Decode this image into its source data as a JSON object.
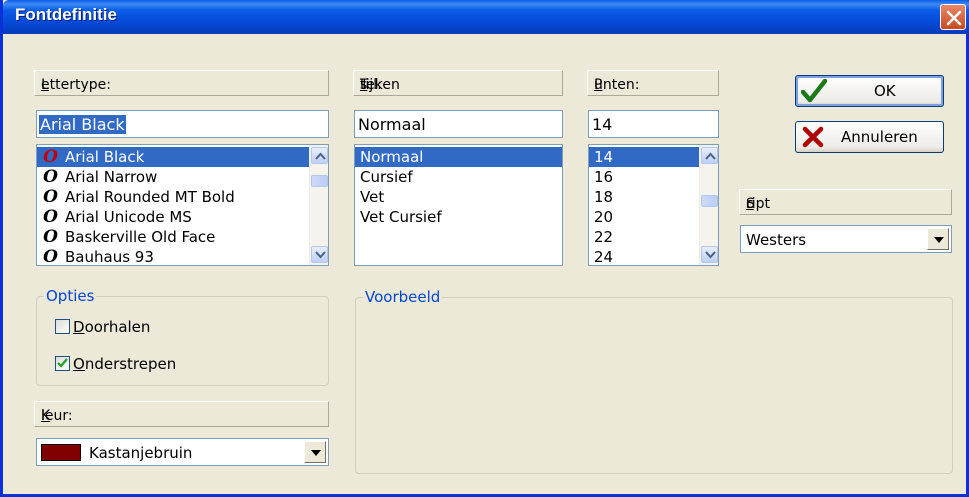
{
  "dialog": {
    "title": "Fontdefinitie"
  },
  "font": {
    "label_prefix": "",
    "label_accel": "L",
    "label_rest": "ettertype:",
    "value": "Arial Black",
    "items": [
      {
        "name": "Arial Black",
        "icon": "opentype-font-icon",
        "selected": true
      },
      {
        "name": "Arial Narrow",
        "icon": "opentype-font-icon",
        "selected": false
      },
      {
        "name": "Arial Rounded MT Bold",
        "icon": "opentype-font-icon",
        "selected": false
      },
      {
        "name": "Arial Unicode MS",
        "icon": "opentype-font-icon",
        "selected": false
      },
      {
        "name": "Baskerville Old Face",
        "icon": "opentype-font-icon",
        "selected": false
      },
      {
        "name": "Bauhaus 93",
        "icon": "opentype-font-icon",
        "selected": false
      }
    ]
  },
  "style": {
    "label_prefix": "Teken",
    "label_accel": "s",
    "label_rest": "tijl:",
    "value": "Normaal",
    "items": [
      "Normaal",
      "Cursief",
      "Vet",
      "Vet Cursief"
    ],
    "selected_index": 0
  },
  "size": {
    "label_prefix": "",
    "label_accel": "P",
    "label_rest": "unten:",
    "value": "14",
    "items": [
      "14",
      "16",
      "18",
      "20",
      "22",
      "24"
    ],
    "selected_index": 0
  },
  "buttons": {
    "ok": "OK",
    "cancel": "Annuleren"
  },
  "script": {
    "label_prefix": "S",
    "label_accel": "c",
    "label_rest": "ript",
    "value": "Westers"
  },
  "options": {
    "legend": "Opties",
    "strikeout": {
      "accel": "D",
      "rest": "oorhalen",
      "checked": false
    },
    "underline": {
      "accel": "O",
      "rest": "nderstrepen",
      "checked": true
    }
  },
  "color": {
    "label_prefix": "",
    "label_accel": "K",
    "label_rest": "leur:",
    "value": "Kastanjebruin",
    "swatch": "#800000"
  },
  "preview": {
    "legend": "Voorbeeld"
  },
  "colors": {
    "titlebar": "#0a5ce8",
    "selection": "#316ac5",
    "group_legend": "#0046d5"
  }
}
